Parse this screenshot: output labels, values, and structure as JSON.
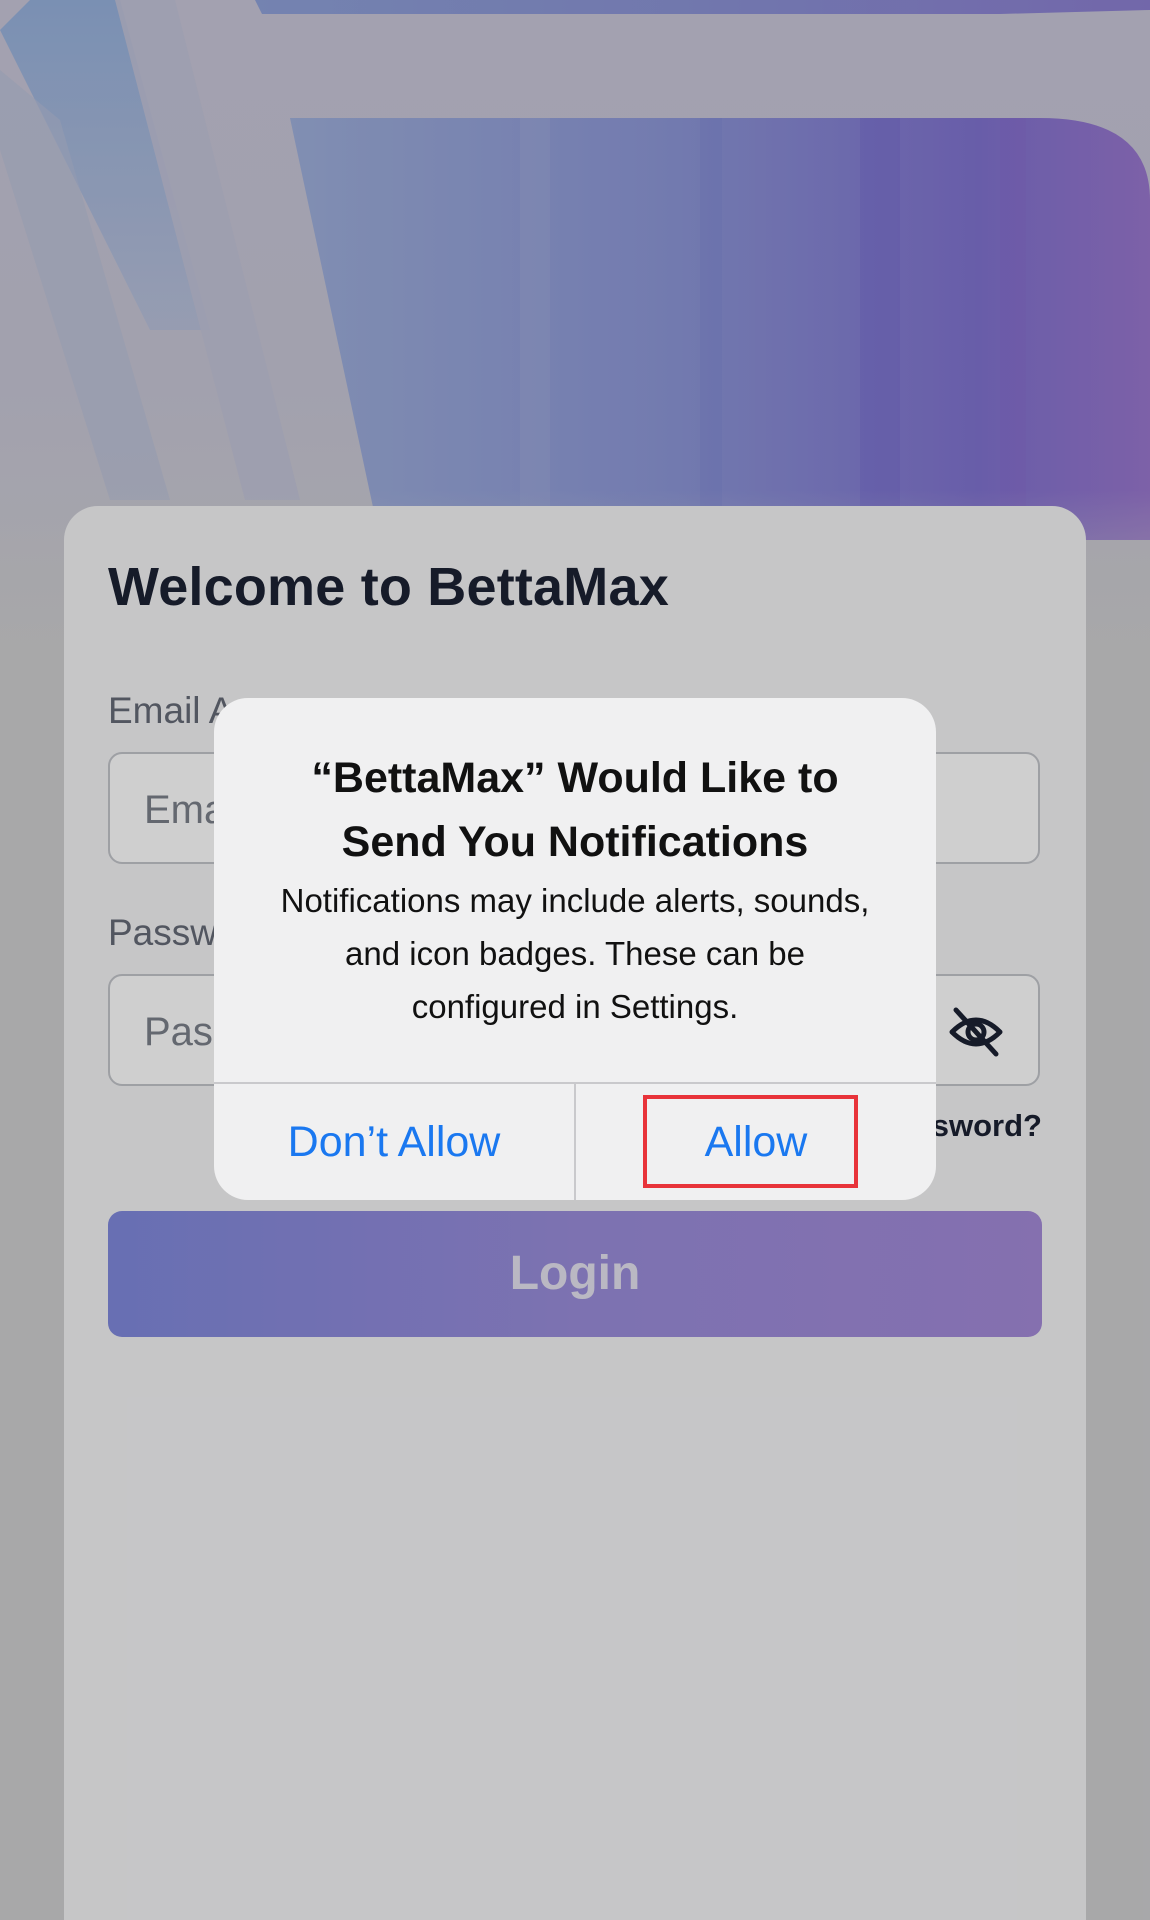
{
  "app": {
    "name": "BettaMax"
  },
  "login": {
    "welcome_title": "Welcome to BettaMax",
    "email_label": "Email A",
    "email_placeholder": "Ema",
    "password_label": "Passw",
    "password_placeholder": "Pas",
    "forgot_password": "sword?",
    "login_button": "Login",
    "password_toggle_icon": "eye-off-icon"
  },
  "alert": {
    "title": "“BettaMax” Would Like to Send You Notifications",
    "message": "Notifications may include alerts, sounds, and icon badges. These can be configured in Settings.",
    "dont_allow_label": "Don’t Allow",
    "allow_label": "Allow"
  },
  "colors": {
    "accent_blue": "#1a78f0",
    "login_gradient_start": "#8089dd",
    "login_gradient_end": "#a48bd8",
    "highlight_red": "#e8333a"
  }
}
